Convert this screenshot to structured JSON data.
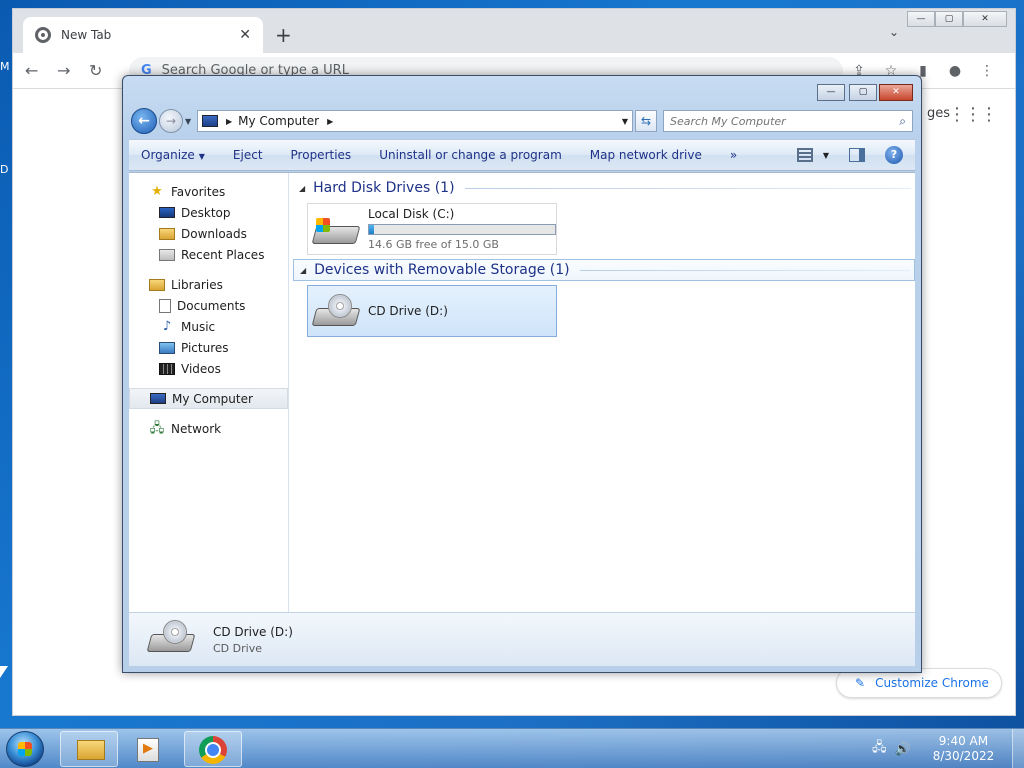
{
  "desktop": {
    "edge_letters": [
      "M",
      "D"
    ]
  },
  "chrome": {
    "tab_title": "New Tab",
    "tab_close": "✕",
    "new_tab": "+",
    "tab_search": "⌄",
    "minimize": "—",
    "maximize": "▢",
    "close": "✕",
    "back": "←",
    "forward": "→",
    "reload": "↻",
    "omnibox_placeholder": "Search Google or type a URL",
    "share": "⇪",
    "star": "☆",
    "side_panel": "▮",
    "profile": "●",
    "menu": "⋮",
    "images_link": "ges",
    "apps_grid": "⋮⋮⋮",
    "customize_label": "Customize Chrome",
    "customize_icon": "✎"
  },
  "explorer": {
    "minimize": "—",
    "maximize": "▢",
    "close": "✕",
    "back": "←",
    "forward": "→",
    "dropdown": "▼",
    "address": {
      "crumb_arrow": "▶",
      "location": "My Computer",
      "trail_arrow": "▶",
      "drop": "▼"
    },
    "refresh": "⇆",
    "search_placeholder": "Search My Computer",
    "search_icon": "⌕",
    "commands": {
      "organize": "Organize",
      "organize_arrow": "▼",
      "eject": "Eject",
      "properties": "Properties",
      "uninstall": "Uninstall or change a program",
      "map_drive": "Map network drive",
      "more": "»",
      "views_arrow": "▼",
      "help": "?"
    },
    "nav": {
      "favorites": "Favorites",
      "desktop": "Desktop",
      "downloads": "Downloads",
      "recent_places": "Recent Places",
      "libraries": "Libraries",
      "documents": "Documents",
      "music": "Music",
      "pictures": "Pictures",
      "videos": "Videos",
      "my_computer": "My Computer",
      "network": "Network",
      "star_glyph": "★",
      "music_glyph": "♪",
      "net_glyph": "🖧"
    },
    "groups": {
      "hdd": {
        "arrow": "◢",
        "title": "Hard Disk Drives (1)"
      },
      "removable": {
        "arrow": "◢",
        "title": "Devices with Removable Storage (1)"
      }
    },
    "drives": {
      "c": {
        "name": "Local Disk (C:)",
        "free_text": "14.6 GB free of 15.0 GB",
        "used_fraction": 0.027
      },
      "d": {
        "name": "CD Drive (D:)"
      }
    },
    "details": {
      "name": "CD Drive (D:)",
      "type": "CD Drive"
    }
  },
  "taskbar": {
    "tray_network": "🖧",
    "tray_volume": "🔊",
    "time": "9:40 AM",
    "date": "8/30/2022"
  }
}
